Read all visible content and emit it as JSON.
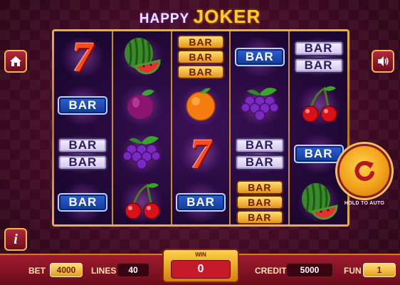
{
  "logo": {
    "word1": "HAPPY",
    "word2": "JOKER"
  },
  "reels": [
    [
      "seven",
      "bar_blue",
      "bar_double",
      "bar_blue"
    ],
    [
      "watermelon",
      "plum",
      "grapes",
      "cherries"
    ],
    [
      "bar_triple",
      "orange",
      "seven",
      "bar_blue"
    ],
    [
      "bar_blue",
      "grapes",
      "bar_double",
      "bar_triple"
    ],
    [
      "bar_double",
      "cherries",
      "bar_blue",
      "watermelon"
    ]
  ],
  "symbol_text": {
    "bar": "BAR",
    "seven": "7"
  },
  "buttons": {
    "home_icon": "home-icon",
    "sound_icon": "speaker-icon",
    "info_icon": "info-icon",
    "info_text": "i",
    "spin_icon": "refresh-icon",
    "hold_label": "HOLD TO AUTO"
  },
  "bottom": {
    "bet_label": "BET",
    "bet_value": "4000",
    "lines_label": "LINES",
    "lines_value": "40",
    "win_label": "WIN",
    "win_value": "0",
    "credit_label": "CREDIT",
    "credit_value": "5000",
    "fun_label": "FUN",
    "fun_value": "1"
  },
  "colors": {
    "background": "#4a0d28",
    "frame_gold": "#e9b040",
    "bar_blue": "#1f4cc0",
    "spin_orange": "#f1a11a"
  }
}
